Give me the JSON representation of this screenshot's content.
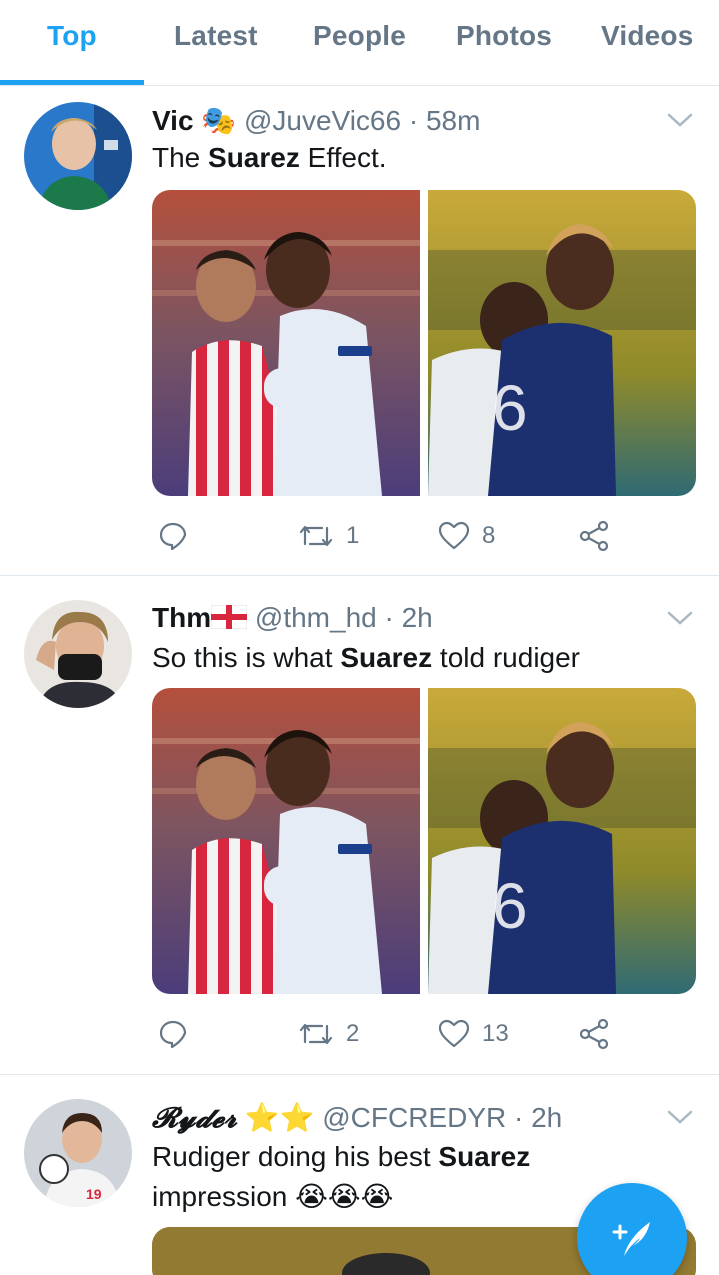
{
  "tabs": [
    "Top",
    "Latest",
    "People",
    "Photos",
    "Videos"
  ],
  "active_tab": "Top",
  "colors": {
    "accent": "#1da1f2",
    "muted": "#657786",
    "text": "#14171a",
    "divider": "#e1e8ed"
  },
  "tweets": [
    {
      "name": "Vic",
      "name_emoji": "🎭",
      "handle": "@JuveVic66",
      "time": "· 58m",
      "text_parts": [
        "The ",
        "Suarez",
        " Effect."
      ],
      "replies_icon": "reply-icon",
      "retweets": "1",
      "likes": "8"
    },
    {
      "name": "Thm",
      "name_emoji": "England flag",
      "handle": "@thm_hd",
      "time": "· 2h",
      "text_parts": [
        "So this is what ",
        "Suarez",
        " told rudiger"
      ],
      "retweets": "2",
      "likes": "13"
    },
    {
      "name": "𝓡𝔂𝓭𝓮𝓻",
      "name_emoji": "⭐⭐",
      "handle": "@CFCREDYR",
      "time": "· 2h",
      "text_parts": [
        "Rudiger doing his best ",
        "Suarez",
        " impression ",
        "😭😭😭"
      ]
    }
  ],
  "fab_icon": "compose-tweet-icon"
}
